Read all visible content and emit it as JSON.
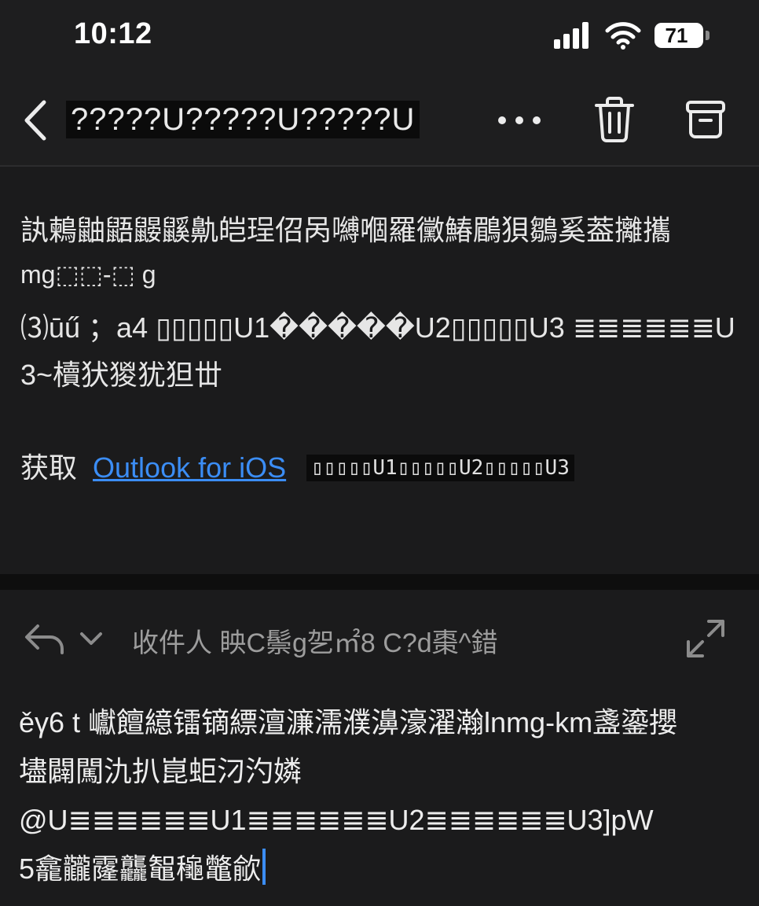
{
  "status_bar": {
    "time": "10:12",
    "battery": "71",
    "icons": [
      "cellular-signal-icon",
      "wifi-icon",
      "battery-icon"
    ]
  },
  "header": {
    "subject": "?????U?????U?????U",
    "icons": [
      "back-chevron-icon",
      "more-dots-icon",
      "trash-icon",
      "archive-icon"
    ]
  },
  "message": {
    "lines": [
      "訙鶫鼬鼯鼹鼷鼽皑珵佋呙嚩嗰羅黴鰆鶥狽鶵奚葢攡攜",
      "mg⬚⬚-⬚ g",
      "⑶ūű ；a4 ▯▯▯▯▯U1�����U2▯▯▯▯▯U3 ≣≣≣≣≣≣U",
      "3~櫝犾猣犹狚丗"
    ],
    "get_prefix": "获取",
    "link_text": "Outlook for iOS",
    "block_text": "▯▯▯▯▯U1▯▯▯▯▯U2▯▯▯▯▯U3"
  },
  "reply": {
    "recipients": "收件人 眏C鬃g乫㎡8 C?d棗^錯",
    "compose_lines": [
      "ěγ6 t 巘饘繶镭镝縹澶濂濡濮濞濠濯瀚lnmg-km盞鎏攖",
      "壗闢闖氿扒崑蚷汈汋嫾",
      "@U≣≣≣≣≣≣U1≣≣≣≣≣≣U2≣≣≣≣≣≣U3]pW",
      "5龕龖霳龘鼅龝鼈歈"
    ],
    "icons": [
      "reply-arrow-icon",
      "chevron-down-icon",
      "expand-icon"
    ]
  },
  "colors": {
    "background": "#1b1b1c",
    "link": "#3b8df5",
    "text": "#e6e6e6",
    "muted": "#9d9d9d"
  }
}
